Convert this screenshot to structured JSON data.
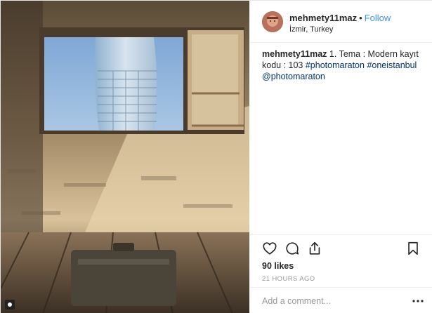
{
  "post": {
    "author": "mehmety11maz",
    "follow_label": "Follow",
    "separator": "•",
    "location": "İzmir, Turkey",
    "caption": {
      "username": "mehmety11maz",
      "text": " 1. Tema : Modern kayıt kodu : 103 ",
      "tags": [
        "#photomaraton",
        "#oneistanbul",
        "@photomaraton"
      ]
    },
    "likes": "90 likes",
    "timestamp": "21 HOURS AGO",
    "comment_placeholder": "Add a comment...",
    "more_label": "•••"
  },
  "icons": {
    "like": "heart-icon",
    "comment": "comment-icon",
    "share": "share-icon",
    "save": "bookmark-icon",
    "more": "more-options-icon"
  },
  "colors": {
    "link": "#3897f0",
    "hashtag": "#003569",
    "meta": "#999999",
    "text": "#262626"
  }
}
